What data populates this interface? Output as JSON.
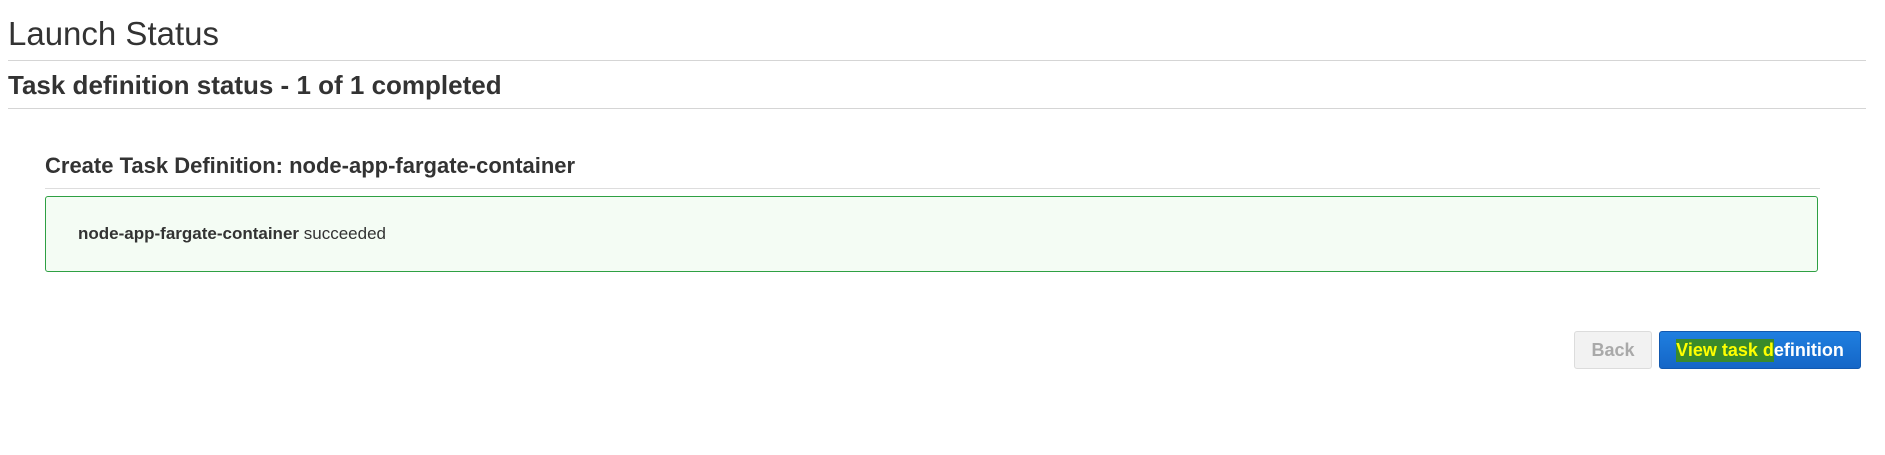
{
  "header": {
    "title": "Launch Status",
    "subtitle": "Task definition status - 1 of 1 completed"
  },
  "section": {
    "title": "Create Task Definition: node-app-fargate-container"
  },
  "alert": {
    "name": "node-app-fargate-container",
    "status": "succeeded",
    "border_color": "#2ea043",
    "background_color": "#f4fcf4"
  },
  "actions": {
    "back_label": "Back",
    "view_label_highlighted": "View task d",
    "view_label_rest": "efinition",
    "primary_color": "#1a73d6"
  }
}
